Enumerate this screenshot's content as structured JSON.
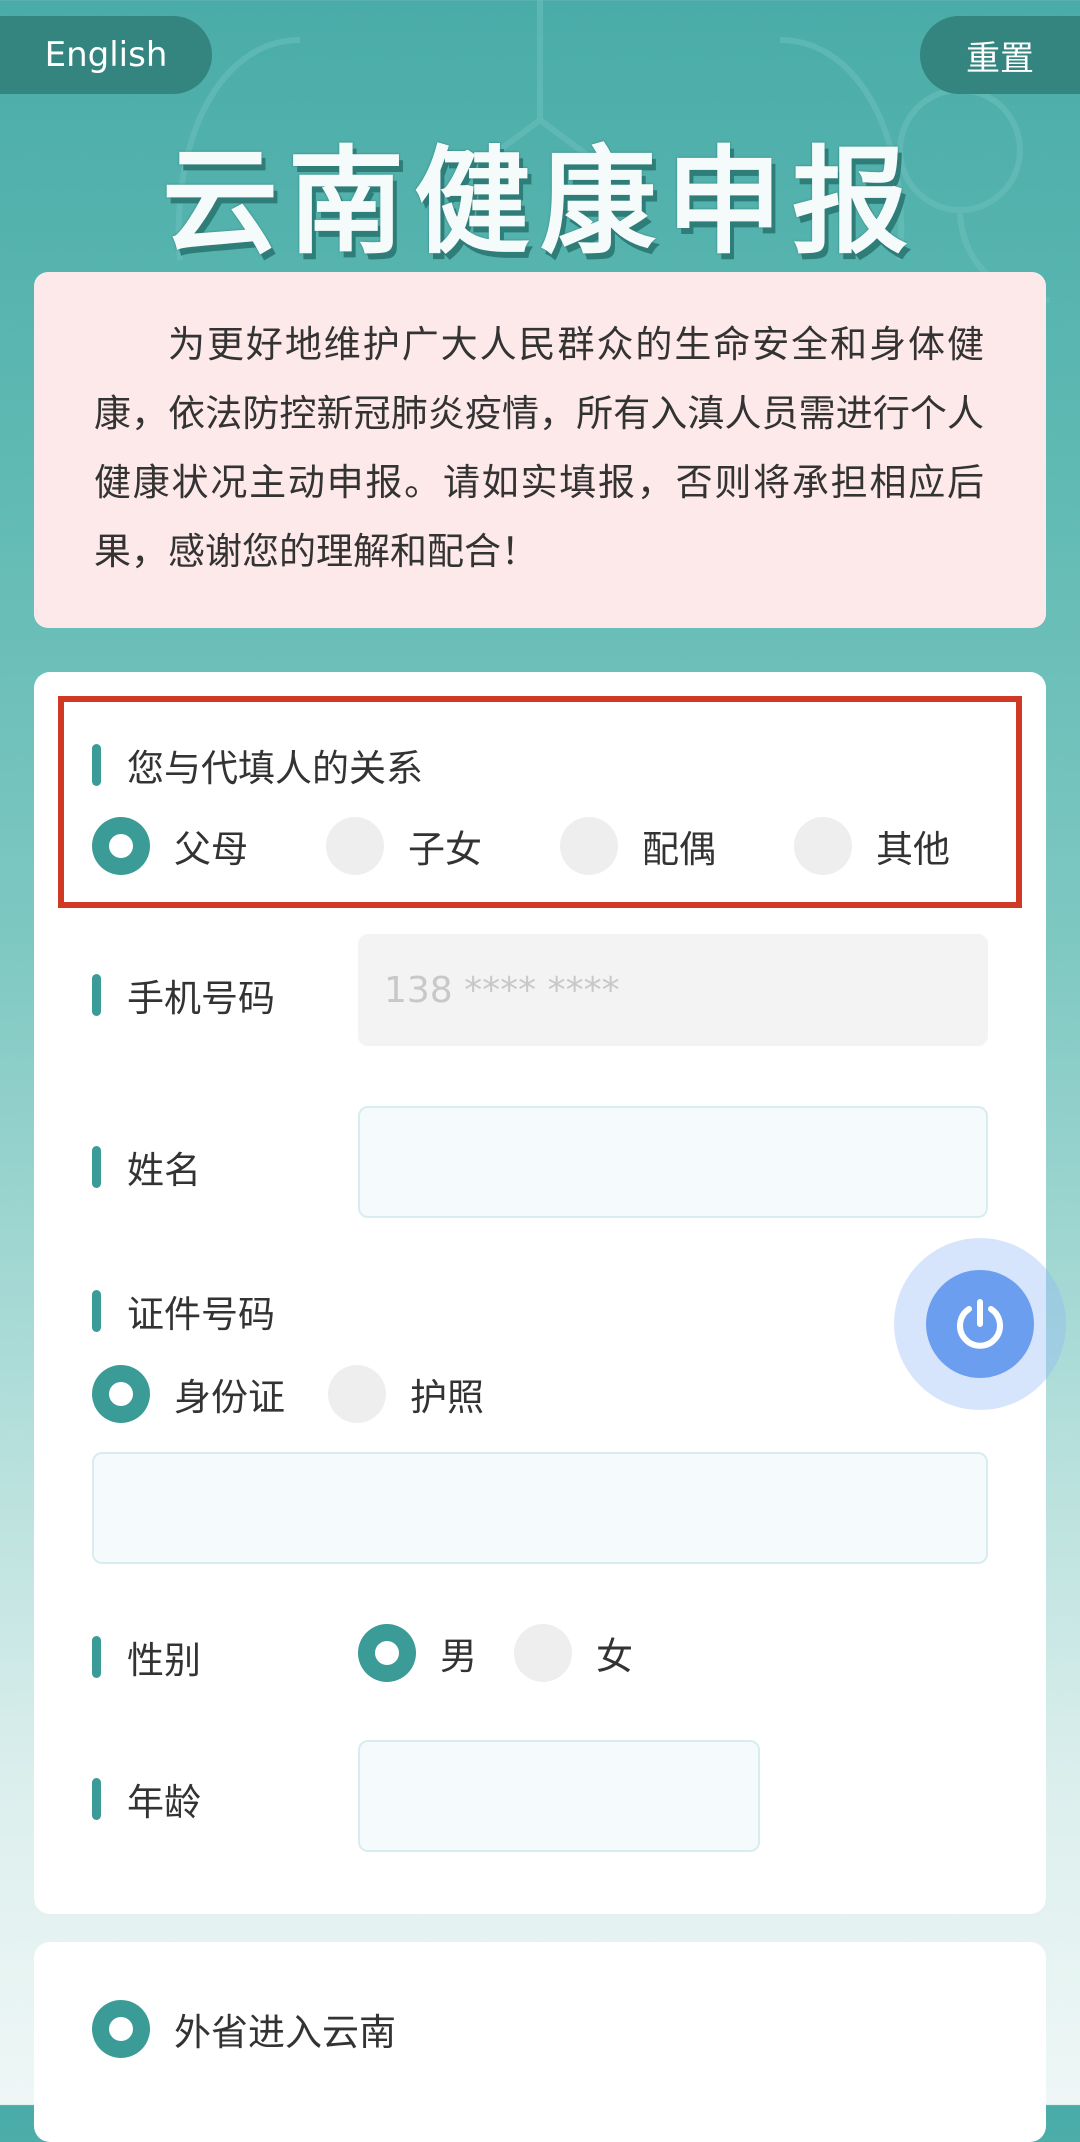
{
  "header": {
    "language_button": "English",
    "reset_button": "重置",
    "title": "云南健康申报"
  },
  "notice": {
    "text": "为更好地维护广大人民群众的生命安全和身体健康，依法防控新冠肺炎疫情，所有入滇人员需进行个人健康状况主动申报。请如实填报，否则将承担相应后果，感谢您的理解和配合！"
  },
  "form": {
    "relationship": {
      "label": "您与代填人的关系",
      "options": [
        "父母",
        "子女",
        "配偶",
        "其他"
      ],
      "selected": "父母"
    },
    "phone": {
      "label": "手机号码",
      "value": "138 **** ****"
    },
    "name": {
      "label": "姓名",
      "value": ""
    },
    "id_number": {
      "label": "证件号码",
      "options": [
        "身份证",
        "护照"
      ],
      "selected": "身份证",
      "value": ""
    },
    "gender": {
      "label": "性别",
      "options": [
        "男",
        "女"
      ],
      "selected": "男"
    },
    "age": {
      "label": "年龄",
      "value": ""
    }
  },
  "entry": {
    "option": "外省进入云南",
    "selected": true
  },
  "colors": {
    "accent": "#3b9c97",
    "highlight_border": "#d03a24",
    "notice_bg": "#fde9ea",
    "power_button": "#6c9ef0"
  },
  "icons": {
    "power": "power-icon"
  }
}
